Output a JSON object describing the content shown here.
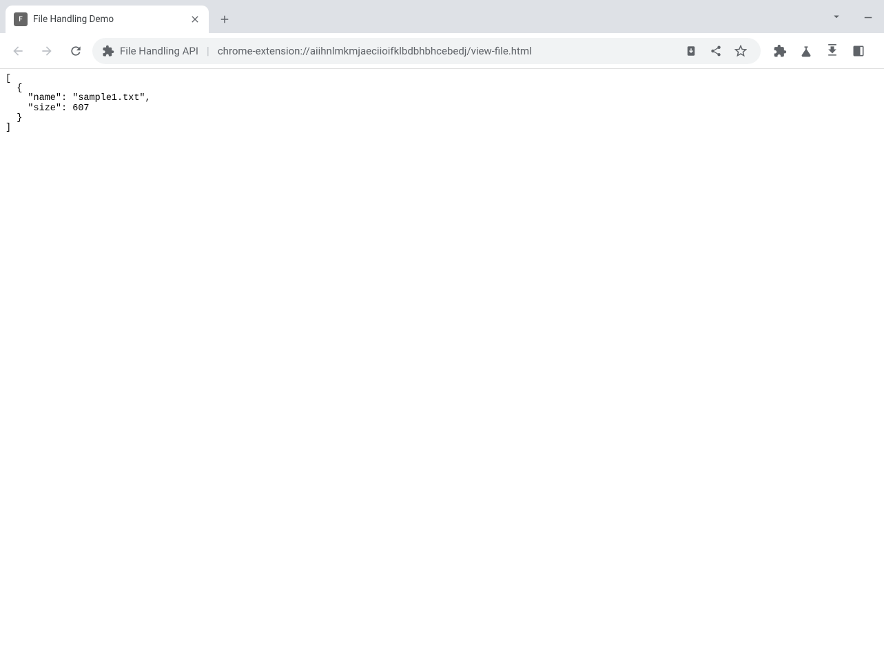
{
  "tab": {
    "favicon_letter": "F",
    "title": "File Handling Demo"
  },
  "omnibox": {
    "identity_label": "File Handling API",
    "url": "chrome-extension://aiihnlmkmjaeciioifklbdbhbhcebedj/view-file.html"
  },
  "page": {
    "json_output": "[\n  {\n    \"name\": \"sample1.txt\",\n    \"size\": 607\n  }\n]"
  }
}
